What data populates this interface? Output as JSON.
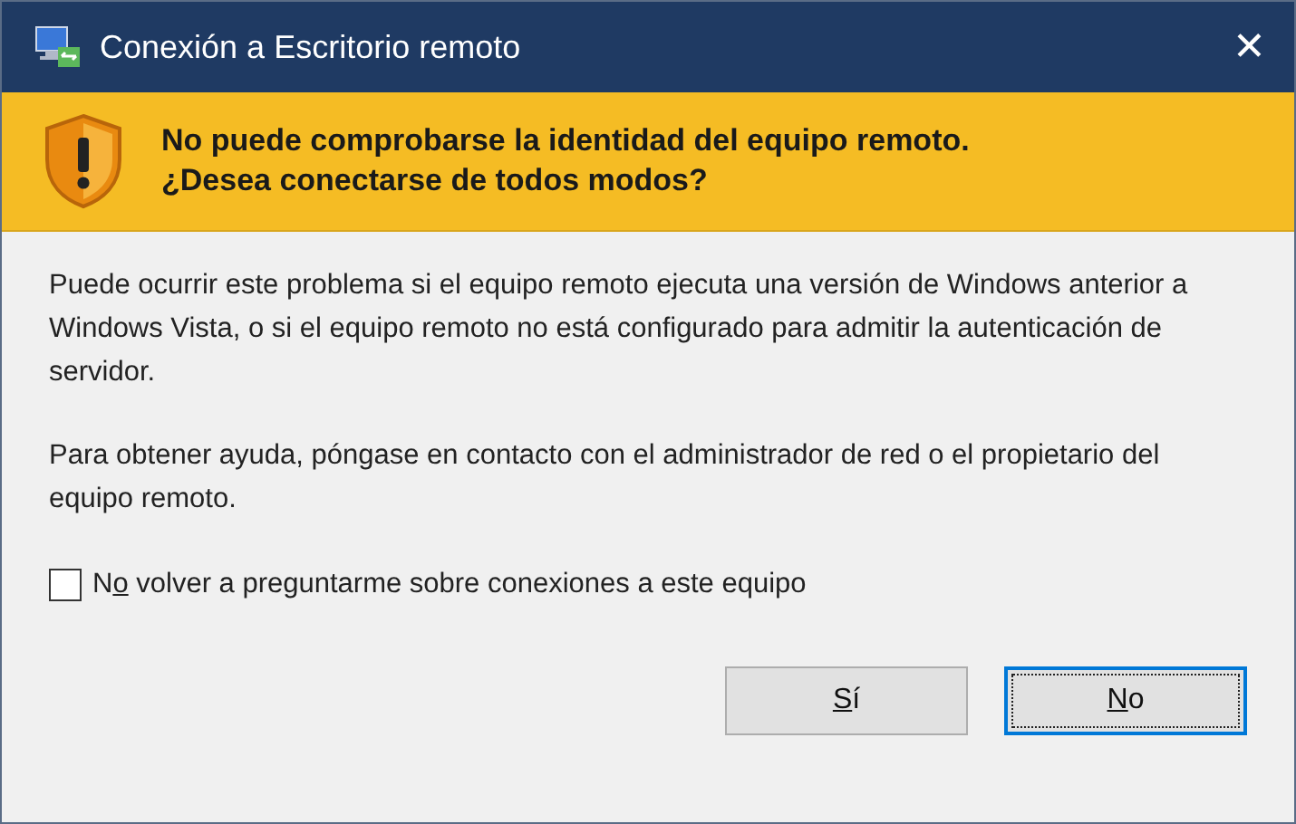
{
  "window": {
    "title": "Conexión a Escritorio remoto",
    "close": "✕"
  },
  "banner": {
    "lines": [
      "No puede comprobarse la identidad del equipo remoto.",
      "¿Desea conectarse de todos modos?"
    ]
  },
  "paragraphs": [
    "Puede ocurrir este problema si el equipo remoto ejecuta una versión de Windows anterior a Windows Vista, o si el equipo remoto no está configurado para admitir la autenticación de servidor.",
    "Para obtener ayuda, póngase en contacto con el administrador de red o el propietario del equipo remoto."
  ],
  "checkbox": {
    "before": "N",
    "key": "o",
    "after": " volver a preguntarme sobre conexiones a este equipo",
    "checked": false
  },
  "buttons": [
    {
      "key": "S",
      "after": "í",
      "default": false
    },
    {
      "key": "N",
      "after": "o",
      "default": true
    }
  ]
}
